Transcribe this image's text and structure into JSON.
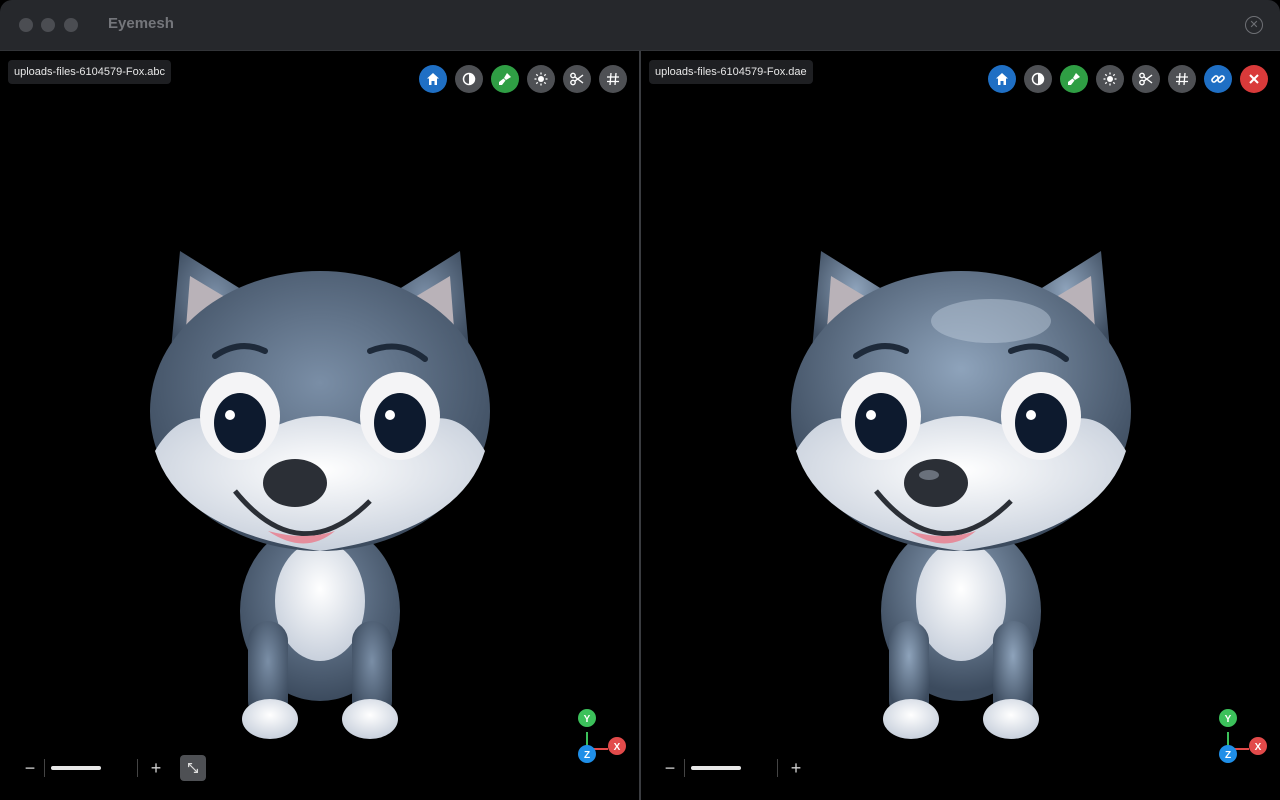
{
  "app": {
    "title": "Eyemesh"
  },
  "window": {
    "close_icon": "close-circle-icon"
  },
  "viewports": [
    {
      "file_name": "uploads-files-6104579-Fox.abc",
      "toolbar": [
        {
          "icon": "home-icon",
          "color": "#1f6fc4"
        },
        {
          "icon": "contrast-icon",
          "color": "#4e5054"
        },
        {
          "icon": "paint-brush-icon",
          "color": "#2f9e44"
        },
        {
          "icon": "sun-icon",
          "color": "#4e5054"
        },
        {
          "icon": "scissors-icon",
          "color": "#4e5054"
        },
        {
          "icon": "grid-icon",
          "color": "#4e5054"
        }
      ],
      "zoom": {
        "minus": "−",
        "plus": "+",
        "level": 0.62
      },
      "axes": {
        "y": "Y",
        "x": "X",
        "z": "Z"
      }
    },
    {
      "file_name": "uploads-files-6104579-Fox.dae",
      "toolbar": [
        {
          "icon": "home-icon",
          "color": "#1f6fc4"
        },
        {
          "icon": "contrast-icon",
          "color": "#4e5054"
        },
        {
          "icon": "paint-brush-icon",
          "color": "#2f9e44"
        },
        {
          "icon": "sun-icon",
          "color": "#4e5054"
        },
        {
          "icon": "scissors-icon",
          "color": "#4e5054"
        },
        {
          "icon": "grid-icon",
          "color": "#4e5054"
        },
        {
          "icon": "link-icon",
          "color": "#1f6fc4"
        },
        {
          "icon": "close-icon",
          "color": "#d93a3a"
        }
      ],
      "zoom": {
        "minus": "−",
        "plus": "+",
        "level": 0.62
      },
      "axes": {
        "y": "Y",
        "x": "X",
        "z": "Z"
      }
    }
  ]
}
